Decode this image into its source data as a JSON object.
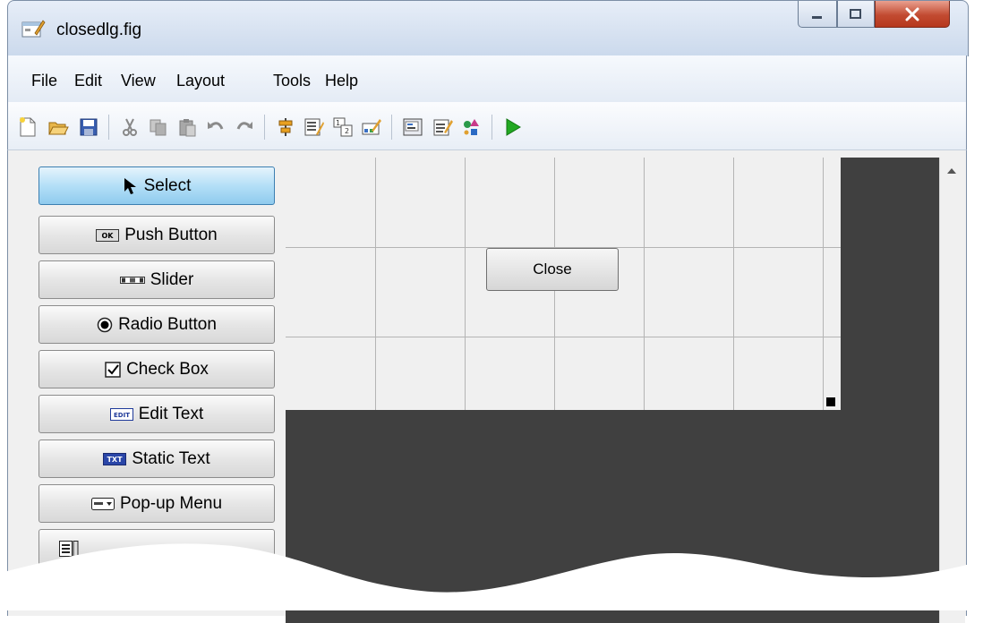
{
  "window": {
    "title": "closedlg.fig",
    "icon": "guide-figure-icon",
    "controls": [
      "minimize-icon",
      "maximize-icon",
      "close-icon"
    ]
  },
  "menu": {
    "items": [
      "File",
      "Edit",
      "View",
      "Layout",
      "Tools",
      "Help"
    ]
  },
  "toolbar": {
    "buttons": [
      "new-icon",
      "open-icon",
      "save-icon",
      "cut-icon",
      "copy-icon",
      "paste-icon",
      "undo-icon",
      "redo-icon",
      "align-icon",
      "menu-editor-icon",
      "tab-order-icon",
      "toolbar-editor-icon",
      "editor-icon",
      "property-inspector-icon",
      "object-browser-icon",
      "run-icon"
    ],
    "run_color": "#22a822"
  },
  "palette": {
    "items": [
      {
        "label": "Select",
        "icon": "arrow-cursor-icon",
        "selected": true
      },
      {
        "label": "Push Button",
        "icon": "push-button-icon"
      },
      {
        "label": "Slider",
        "icon": "slider-icon"
      },
      {
        "label": "Radio Button",
        "icon": "radio-button-icon"
      },
      {
        "label": "Check Box",
        "icon": "check-box-icon"
      },
      {
        "label": "Edit Text",
        "icon": "edit-text-icon"
      },
      {
        "label": "Static Text",
        "icon": "static-text-icon"
      },
      {
        "label": "Pop-up Menu",
        "icon": "popup-menu-icon"
      },
      {
        "label": "",
        "icon": "listbox-icon"
      }
    ],
    "selected_color": "#9fd3f2",
    "icon_glyphs": {
      "push_button": "OK",
      "edit_text": "EDIT",
      "static_text": "TXT"
    }
  },
  "canvas": {
    "button_label": "Close",
    "background": "#f0f0f0",
    "outside_color": "#404040"
  }
}
